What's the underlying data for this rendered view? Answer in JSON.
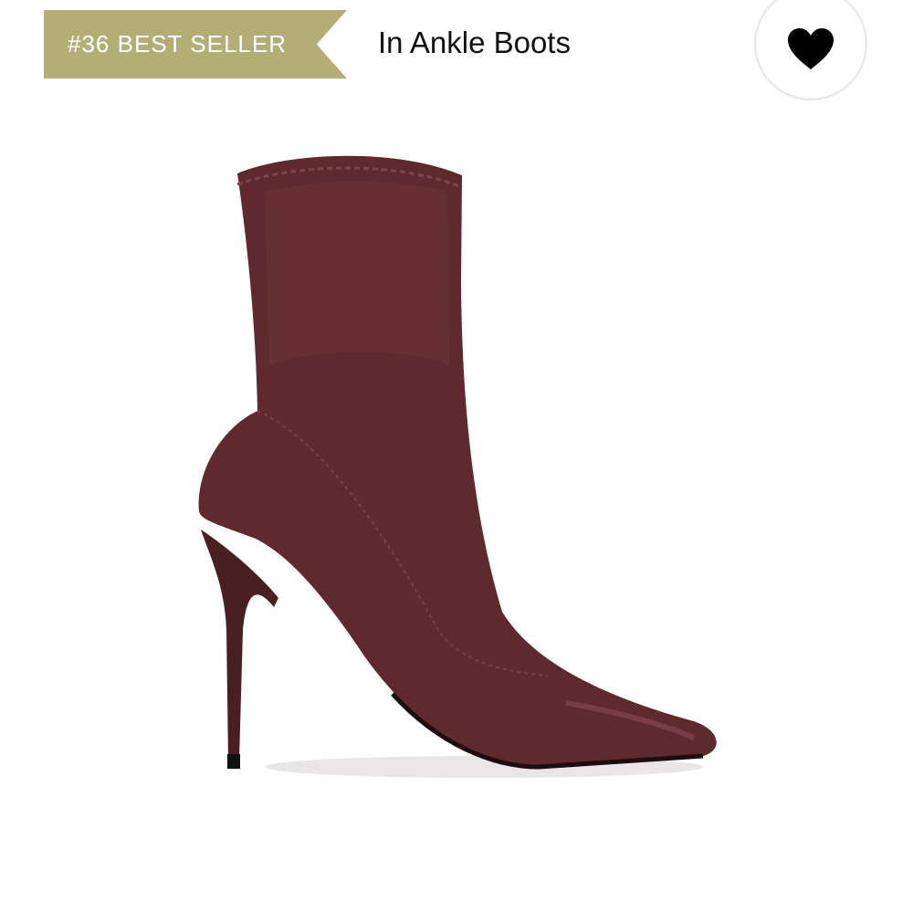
{
  "badge": {
    "text": "#36 BEST SELLER",
    "color": "#b5ad76"
  },
  "category": {
    "text": "In Ankle Boots"
  },
  "favorite": {
    "icon": "heart-icon",
    "color": "#000000"
  },
  "product": {
    "image_subject": "ankle-boot-image",
    "color": "#5e2a2d"
  }
}
